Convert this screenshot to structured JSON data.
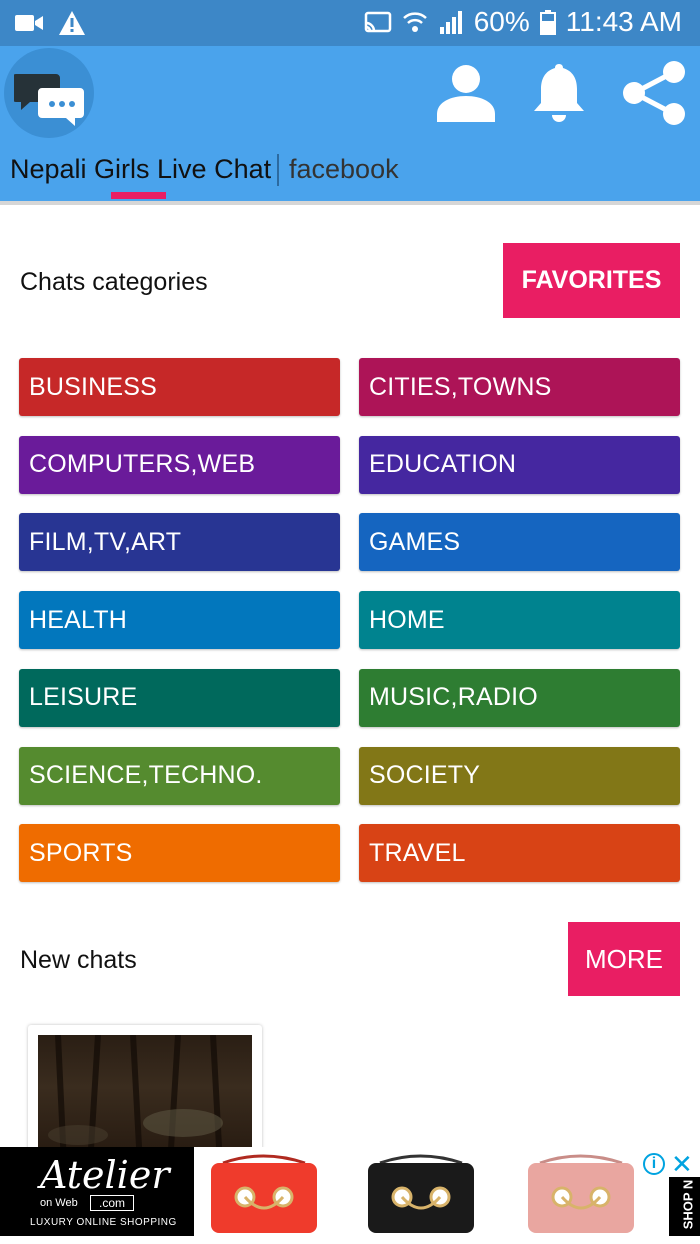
{
  "status_bar": {
    "battery": "60%",
    "time": "11:43 AM"
  },
  "header": {
    "tabs": [
      {
        "label": "Nepali Girls Live Chat"
      },
      {
        "label": "facebook"
      }
    ]
  },
  "categories_section": {
    "title": "Chats categories",
    "favorites_label": "FAVORITES",
    "items": [
      {
        "label": "BUSINESS",
        "color": "#c62828"
      },
      {
        "label": "CITIES,TOWNS",
        "color": "#ad1457"
      },
      {
        "label": "COMPUTERS,WEB",
        "color": "#6a1b9a"
      },
      {
        "label": "EDUCATION",
        "color": "#4527a0"
      },
      {
        "label": "FILM,TV,ART",
        "color": "#283593"
      },
      {
        "label": "GAMES",
        "color": "#1565c0"
      },
      {
        "label": "HEALTH",
        "color": "#0277bd"
      },
      {
        "label": "HOME",
        "color": "#00838f"
      },
      {
        "label": "LEISURE",
        "color": "#00695c"
      },
      {
        "label": "MUSIC,RADIO",
        "color": "#2e7d32"
      },
      {
        "label": "SCIENCE,TECHNO.",
        "color": "#558b2f"
      },
      {
        "label": "SOCIETY",
        "color": "#827717"
      },
      {
        "label": "SPORTS",
        "color": "#ef6c00"
      },
      {
        "label": "TRAVEL",
        "color": "#d84315"
      }
    ]
  },
  "new_chats_section": {
    "title": "New chats",
    "more_label": "MORE"
  },
  "ad": {
    "brand": "Atelier",
    "brand_sub": "on Web",
    "brand_domain": ".com",
    "tagline": "LUXURY ONLINE SHOPPING",
    "shop_label": "SHOP N"
  },
  "colors": {
    "accent": "#e91e63",
    "app_bar": "#4aa3ec",
    "status_bar": "#3d87c7"
  }
}
